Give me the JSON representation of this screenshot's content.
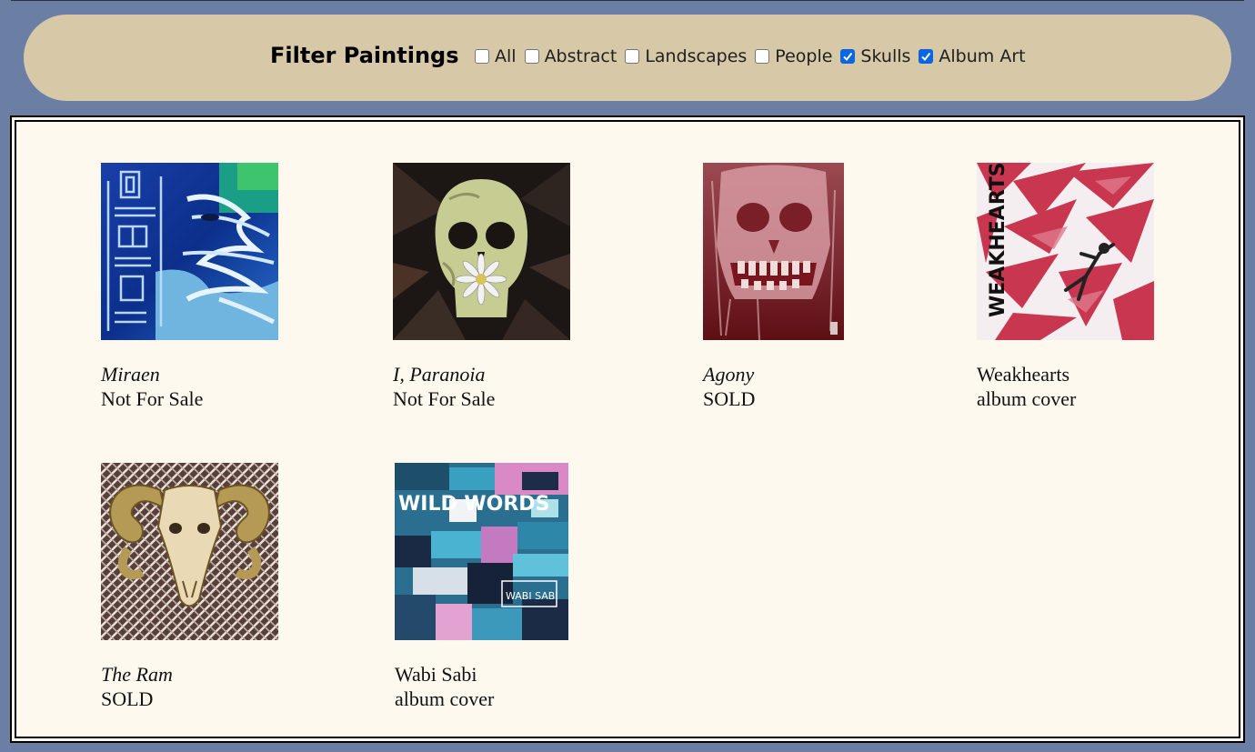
{
  "filter": {
    "title": "Filter Paintings",
    "options": [
      {
        "label": "All",
        "checked": false
      },
      {
        "label": "Abstract",
        "checked": false
      },
      {
        "label": "Landscapes",
        "checked": false
      },
      {
        "label": "People",
        "checked": false
      },
      {
        "label": "Skulls",
        "checked": true
      },
      {
        "label": "Album Art",
        "checked": true
      }
    ]
  },
  "gallery": {
    "items": [
      {
        "title": "Miraen",
        "status": "Not For Sale",
        "italic": true
      },
      {
        "title": "I, Paranoia",
        "status": "Not For Sale",
        "italic": true
      },
      {
        "title": "Agony",
        "status": "SOLD",
        "italic": true
      },
      {
        "title": "Weakhearts",
        "status": "album cover",
        "italic": false
      },
      {
        "title": "The Ram",
        "status": "SOLD",
        "italic": true
      },
      {
        "title": "Wabi Sabi",
        "status": "album cover",
        "italic": false
      }
    ]
  },
  "artwork_text": {
    "weakhearts": "WEAKHEARTS",
    "wild_words": "WILD WORDS",
    "wabi_sabi": "WABI SABI"
  },
  "colors": {
    "page_background": "#6b7ea3",
    "filter_bar": "#d7c9a7",
    "gallery_background": "#fdf9ef",
    "checkbox_checked": "#0a66e0"
  }
}
